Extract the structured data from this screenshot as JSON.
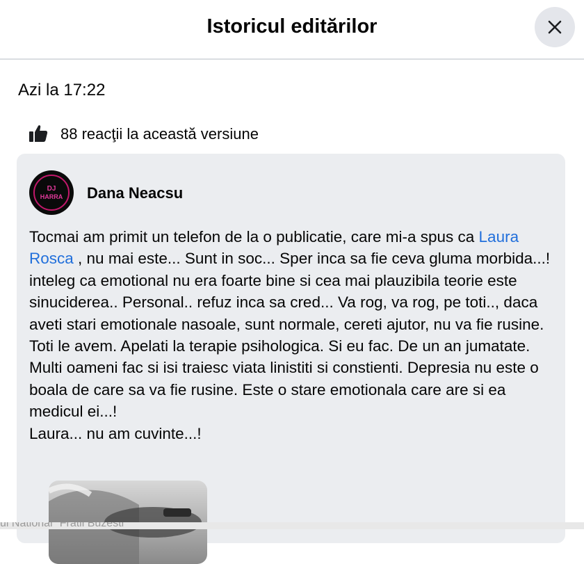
{
  "header": {
    "title": "Istoricul editărilor",
    "close_icon": "close-icon"
  },
  "version": {
    "timestamp": "Azi la 17:22",
    "reactions_icon": "thumbs-up-icon",
    "reactions_text": "88 reacţii la această versiune"
  },
  "post": {
    "author": "Dana Neacsu",
    "avatar_text": "DJ HARRA",
    "paragraph1_before": "Tocmai am primit un telefon de la o publicatie, care mi-a spus ca ",
    "mention": "Laura Rosca",
    "paragraph1_after": " , nu mai este... Sunt in soc... Sper inca sa fie ceva gluma morbida...!",
    "paragraph2": "inteleg ca emotional nu era foarte bine si cea mai plauzibila teorie este sinuciderea.. Personal.. refuz inca sa cred... Va rog, va rog, pe toti.., daca aveti stari emotionale nasoale, sunt normale, cereti ajutor, nu va fie rusine. Toti le avem. Apelati la terapie psihologica. Si eu fac. De un an jumatate. Multi oameni fac si isi traiesc viata linistiti si constienti. Depresia nu este o boala de care sa va fie rusine. Este o stare emotionala care are si ea medicul ei...!",
    "paragraph3": "Laura... nu am cuvinte...!"
  },
  "bottom_strip_text": "ul National \"Fratii Buzesti\"",
  "colors": {
    "accent_link": "#216fdb",
    "card_background": "#ebedf0",
    "close_button_background": "#e4e6eb"
  }
}
